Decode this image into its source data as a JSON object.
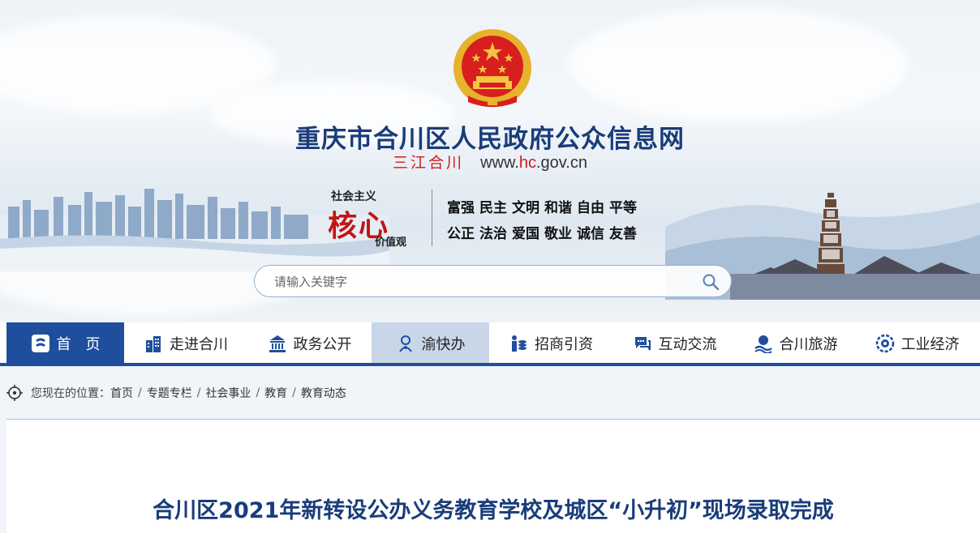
{
  "header": {
    "site_title": "重庆市合川区人民政府公众信息网",
    "slogan": "三江合川",
    "url_prefix": "www.",
    "url_highlight": "hc",
    "url_suffix": ".gov.cn",
    "core_values": {
      "label_top": "社会主义",
      "label_big": "核心",
      "label_bottom": "价值观",
      "row1": [
        "富强",
        "民主",
        "文明",
        "和谐",
        "自由",
        "平等"
      ],
      "row2": [
        "公正",
        "法治",
        "爱国",
        "敬业",
        "诚信",
        "友善"
      ]
    }
  },
  "search": {
    "placeholder": "请输入关键字"
  },
  "nav": {
    "items": [
      {
        "label": "首　页",
        "icon": "home-icon"
      },
      {
        "label": "走进合川",
        "icon": "buildings-icon"
      },
      {
        "label": "政务公开",
        "icon": "government-building-icon"
      },
      {
        "label": "渝快办",
        "icon": "service-person-icon"
      },
      {
        "label": "招商引资",
        "icon": "investment-icon"
      },
      {
        "label": "互动交流",
        "icon": "chat-icon"
      },
      {
        "label": "合川旅游",
        "icon": "tourism-icon"
      },
      {
        "label": "工业经济",
        "icon": "industry-gear-icon"
      }
    ],
    "home_color": "#1f4f9c",
    "active_color": "#c9d6e8"
  },
  "breadcrumb": {
    "prefix": "您现在的位置：",
    "items": [
      "首页",
      "专题专栏",
      "社会事业",
      "教育",
      "教育动态"
    ]
  },
  "article": {
    "title": "合川区2021年新转设公办义务教育学校及城区“小升初”现场录取完成"
  },
  "colors": {
    "title_blue": "#1a3c7a",
    "accent_red": "#d11a1a"
  }
}
